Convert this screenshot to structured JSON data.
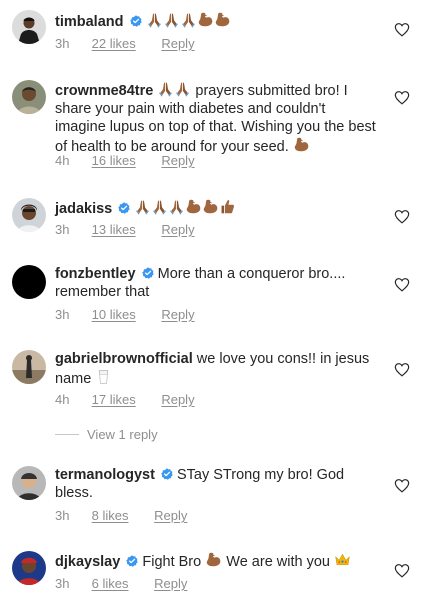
{
  "comments": [
    {
      "username": "timbaland",
      "verified": true,
      "text": "",
      "emojis": [
        "pray-emoji",
        "pray-emoji",
        "pray-emoji",
        "muscle-emoji",
        "muscle-emoji"
      ],
      "time": "3h",
      "likes": "22 likes",
      "reply": "Reply"
    },
    {
      "username": "crownme84tre",
      "verified": false,
      "text_pre": "",
      "text": "prayers submitted bro! I share your pain with diabetes and couldn't imagine lupus on top of that. Wishing you the best of health to be around for your seed.",
      "time": "4h",
      "likes": "16 likes",
      "reply": "Reply"
    },
    {
      "username": "jadakiss",
      "verified": true,
      "text": "",
      "time": "3h",
      "likes": "13 likes",
      "reply": "Reply"
    },
    {
      "username": "fonzbentley",
      "verified": true,
      "text": "More than a conqueror bro.... remember that",
      "time": "3h",
      "likes": "10 likes",
      "reply": "Reply"
    },
    {
      "username": "gabrielbrownofficial",
      "verified": false,
      "text": "we love you cons!! in jesus name",
      "time": "4h",
      "likes": "17 likes",
      "reply": "Reply"
    },
    {
      "username": "termanologyst",
      "verified": true,
      "text": "STay STrong my bro! God bless.",
      "time": "3h",
      "likes": "8 likes",
      "reply": "Reply"
    },
    {
      "username": "djkayslay",
      "verified": true,
      "text_a": "Fight Bro",
      "text_b": "We are with you",
      "time": "3h",
      "likes": "6 likes",
      "reply": "Reply"
    }
  ],
  "view_replies": "View 1 reply",
  "colors": {
    "text": "#262626",
    "muted": "#8e8e8e",
    "verified": "#3897f0",
    "skin": "#a0673f"
  }
}
